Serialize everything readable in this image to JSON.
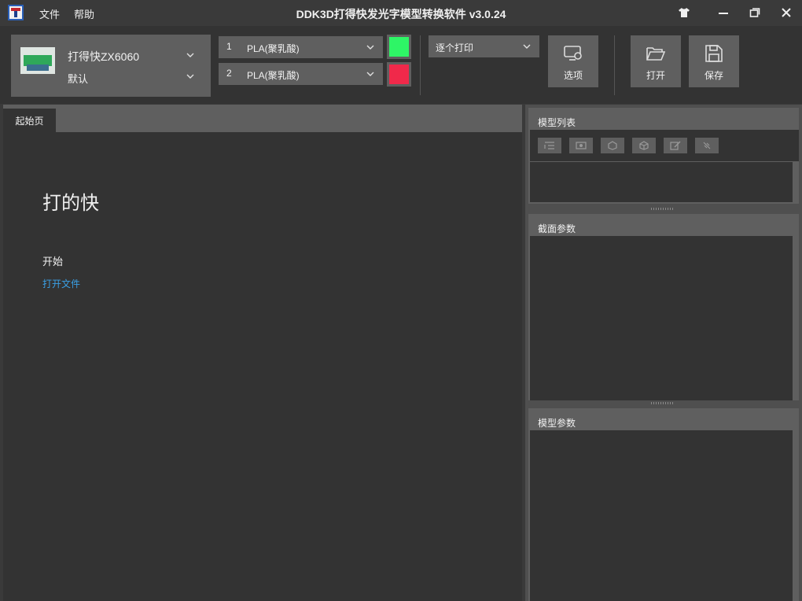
{
  "titlebar": {
    "menu": [
      "文件",
      "帮助"
    ],
    "title": "DDK3D打得快发光字模型转换软件 v3.0.24",
    "icons": [
      "shirt-icon",
      "minimize-icon",
      "restore-icon",
      "close-icon"
    ]
  },
  "toolbar": {
    "printer": {
      "name": "打得快ZX6060",
      "profile": "默认"
    },
    "filaments": [
      {
        "index": "1",
        "material": "PLA(聚乳酸)",
        "color": "#2ef566"
      },
      {
        "index": "2",
        "material": "PLA(聚乳酸)",
        "color": "#f0294a"
      }
    ],
    "print_mode": "逐个打印",
    "buttons": {
      "options": "选项",
      "open": "打开",
      "save": "保存"
    }
  },
  "tabs": [
    {
      "label": "起始页"
    }
  ],
  "start_page": {
    "title": "打的快",
    "section": "开始",
    "open_file_link": "打开文件"
  },
  "right_panels": {
    "model_list": {
      "title": "模型列表"
    },
    "section_params": {
      "title": "截面参数"
    },
    "model_params": {
      "title": "模型参数"
    }
  }
}
